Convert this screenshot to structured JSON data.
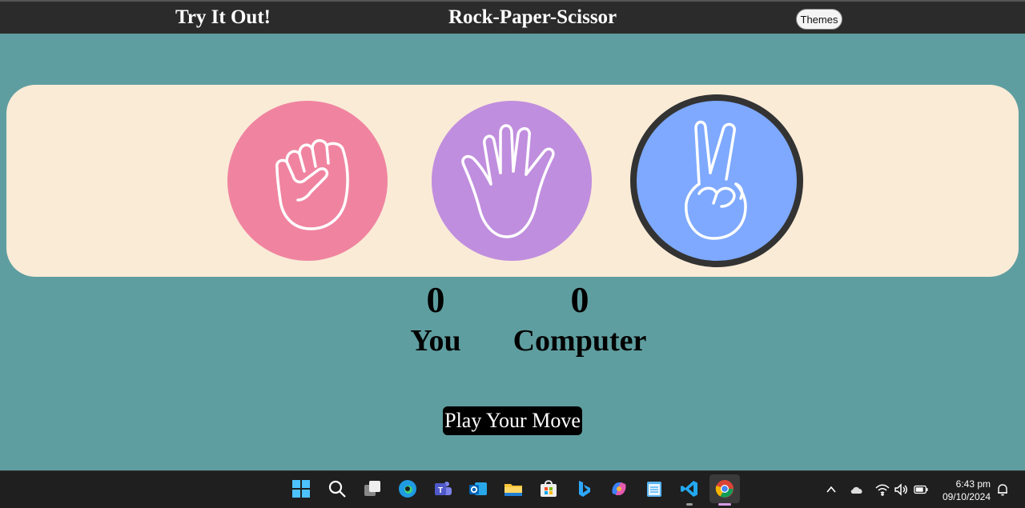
{
  "header": {
    "brand": "Try It Out!",
    "title": "Rock-Paper-Scissor",
    "themes_label": "Themes"
  },
  "choices": [
    {
      "name": "rock",
      "icon": "fist-icon",
      "color": "#f084a0"
    },
    {
      "name": "paper",
      "icon": "open-hand-icon",
      "color": "#c08ede"
    },
    {
      "name": "scissor",
      "icon": "peace-sign-icon",
      "color": "#7ea9fe",
      "selected": true
    }
  ],
  "score": {
    "user_score": "0",
    "user_label": "You",
    "computer_score": "0",
    "computer_label": "Computer"
  },
  "message": {
    "text": "Play Your Move"
  },
  "colors": {
    "background": "#5f9ea0",
    "header": "#2b2b2b",
    "panel": "#faebd7"
  },
  "taskbar": {
    "apps": [
      "windows-start-icon",
      "search-icon",
      "task-view-icon",
      "edge-icon",
      "teams-icon",
      "outlook-icon",
      "file-explorer-icon",
      "microsoft-store-icon",
      "bing-icon",
      "copilot-icon",
      "notepad-icon",
      "vscode-icon",
      "chrome-icon"
    ],
    "tray": [
      "chevron-up-icon",
      "onedrive-cloud-icon",
      "wifi-icon",
      "volume-icon",
      "battery-icon"
    ],
    "time": "6:43 pm",
    "date": "09/10/2024"
  }
}
